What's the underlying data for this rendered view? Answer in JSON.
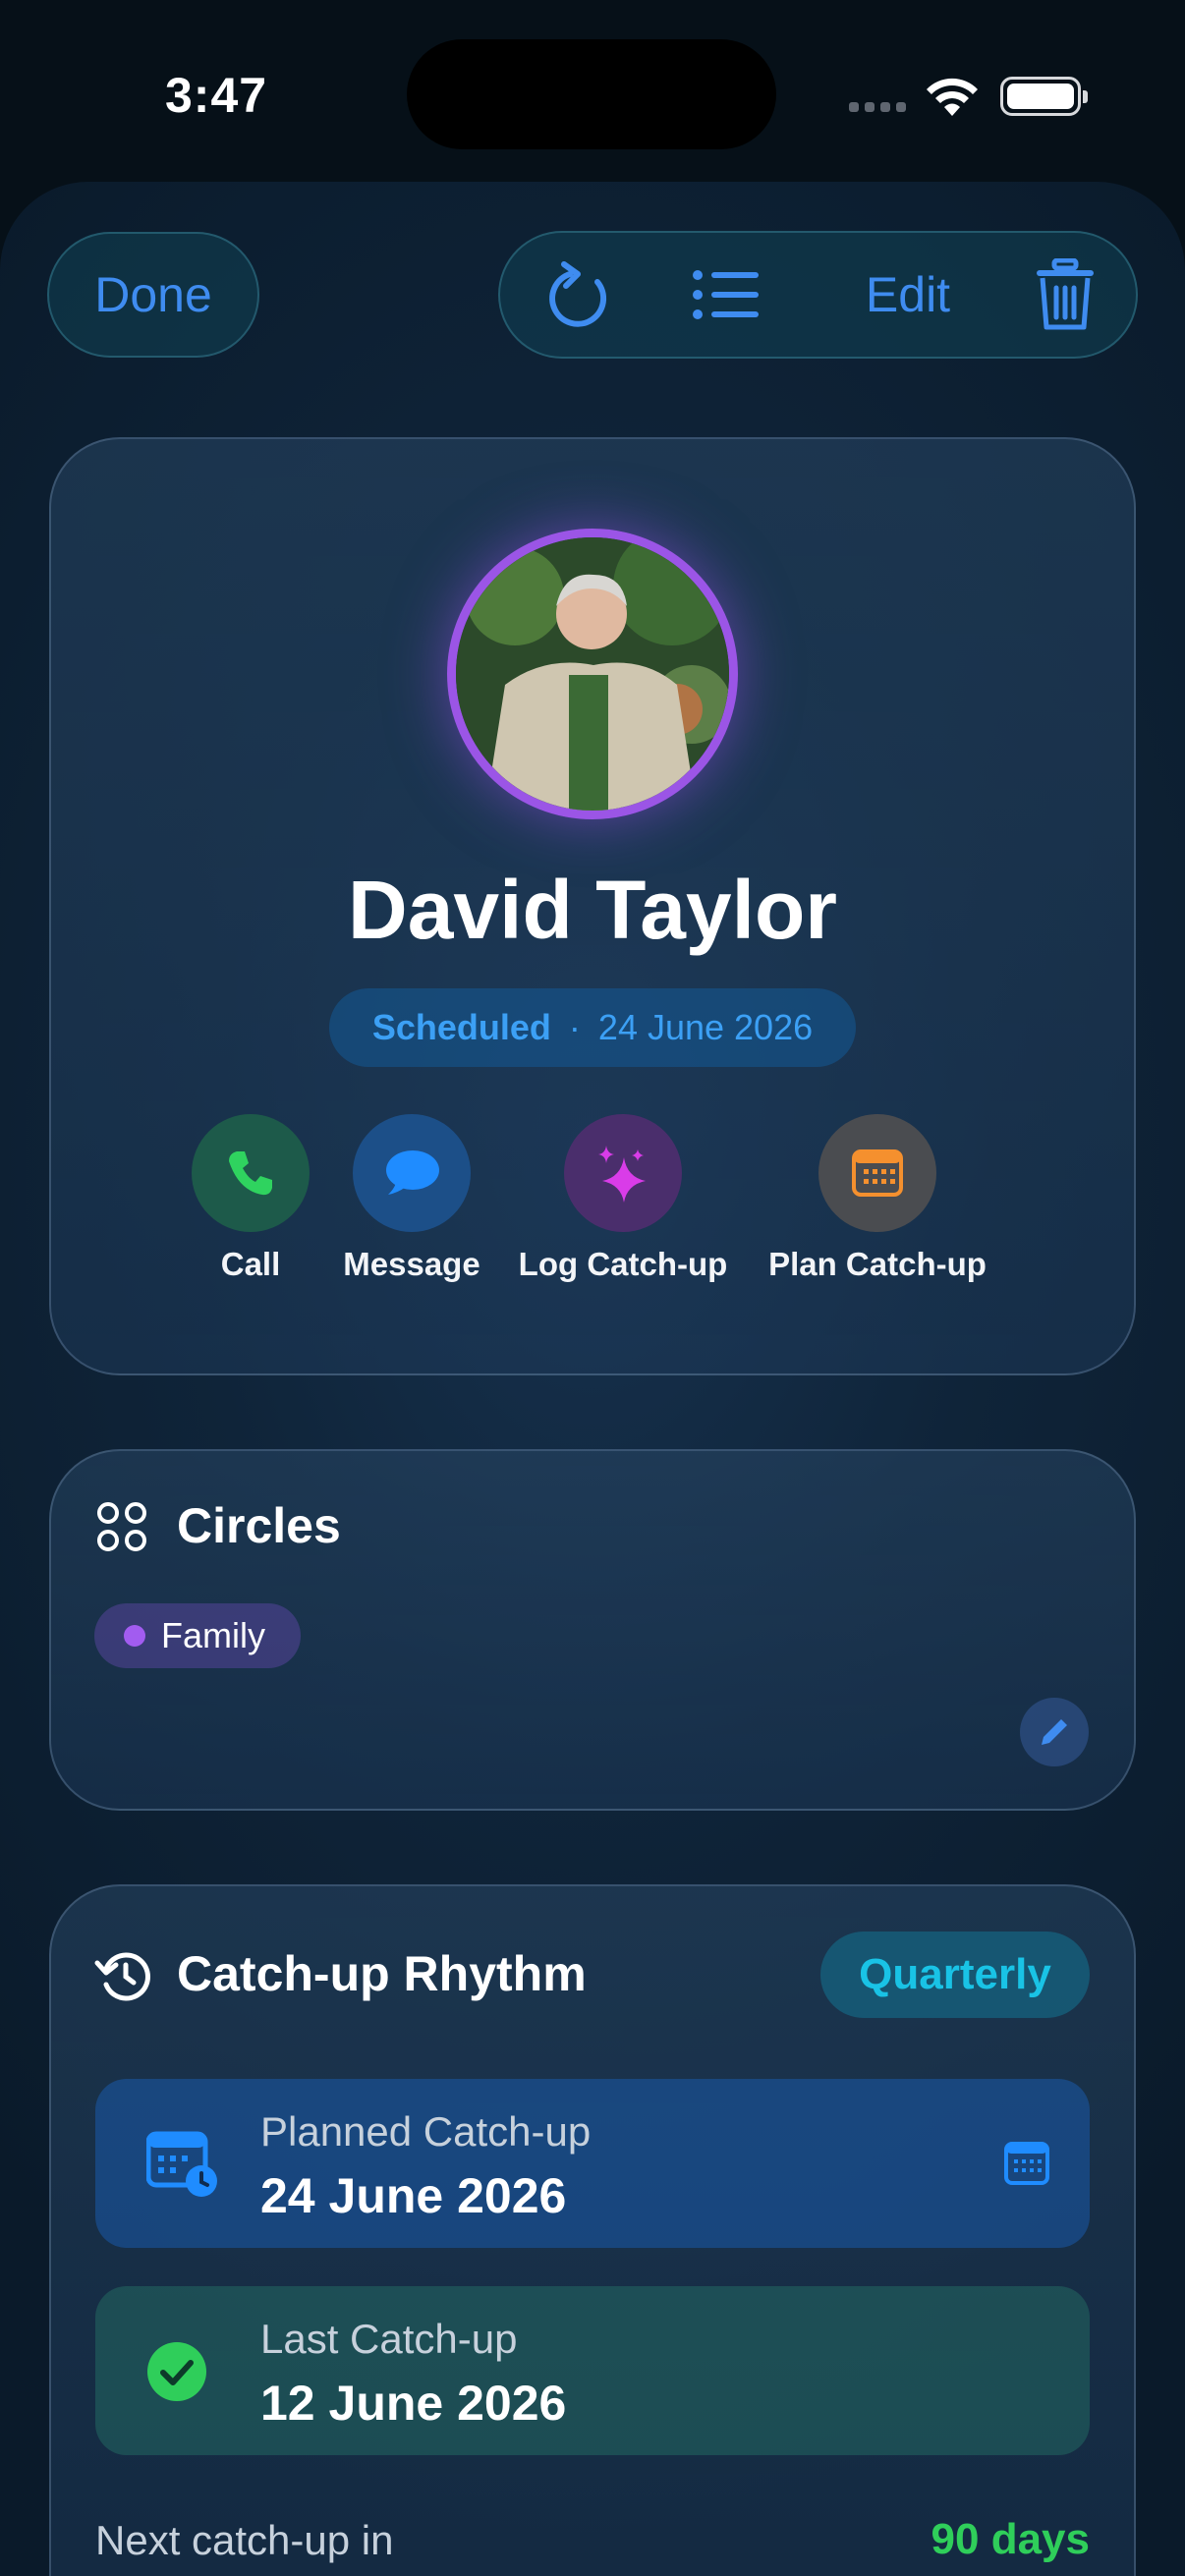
{
  "status_bar": {
    "time": "3:47"
  },
  "toolbar": {
    "done_label": "Done",
    "edit_label": "Edit",
    "icons": [
      "refresh-icon",
      "list-icon",
      "trash-icon"
    ],
    "accent": "#3f8cf0"
  },
  "profile": {
    "name": "David Taylor",
    "status": "Scheduled",
    "separator": "·",
    "status_date": "24 June 2026",
    "ring_color": "#9b55e6"
  },
  "actions": [
    {
      "label": "Call",
      "icon": "phone-icon"
    },
    {
      "label": "Message",
      "icon": "message-bubble-icon"
    },
    {
      "label": "Log Catch-up",
      "icon": "sparkle-icon"
    },
    {
      "label": "Plan Catch-up",
      "icon": "calendar-icon"
    }
  ],
  "circles": {
    "title": "Circles",
    "chips": [
      {
        "label": "Family",
        "color": "#a25cf0"
      }
    ]
  },
  "rhythm": {
    "title": "Catch-up Rhythm",
    "frequency": "Quarterly",
    "planned": {
      "label": "Planned Catch-up",
      "value": "24 June 2026"
    },
    "last": {
      "label": "Last Catch-up",
      "value": "12 June 2026"
    },
    "next_label": "Next catch-up in",
    "next_value": "90 days",
    "next_color": "#2fce5a"
  }
}
